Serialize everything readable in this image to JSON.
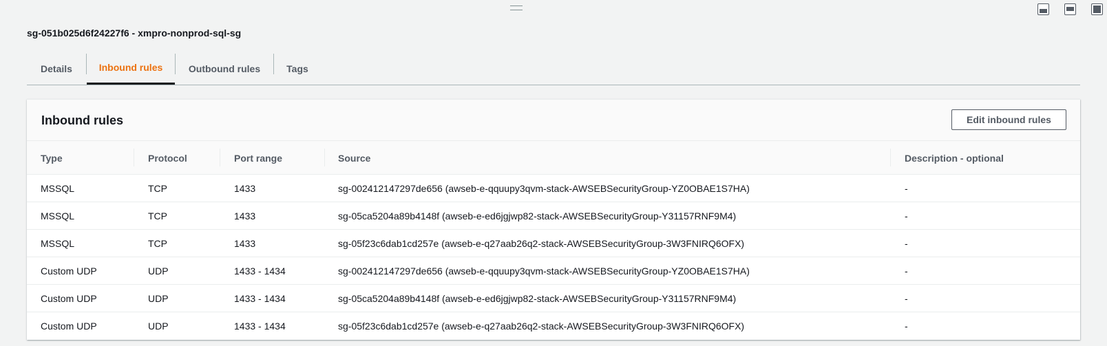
{
  "security_group_title": "sg-051b025d6f24227f6 - xmpro-nonprod-sql-sg",
  "tabs": [
    {
      "label": "Details"
    },
    {
      "label": "Inbound rules"
    },
    {
      "label": "Outbound rules"
    },
    {
      "label": "Tags"
    }
  ],
  "active_tab": "Inbound rules",
  "panel": {
    "title": "Inbound rules",
    "edit_button_label": "Edit inbound rules"
  },
  "table": {
    "columns": [
      "Type",
      "Protocol",
      "Port range",
      "Source",
      "Description - optional"
    ],
    "rows": [
      {
        "type": "MSSQL",
        "protocol": "TCP",
        "port_range": "1433",
        "source": "sg-002412147297de656 (awseb-e-qquupy3qvm-stack-AWSEBSecurityGroup-YZ0OBAE1S7HA)",
        "description": "-"
      },
      {
        "type": "MSSQL",
        "protocol": "TCP",
        "port_range": "1433",
        "source": "sg-05ca5204a89b4148f (awseb-e-ed6jgjwp82-stack-AWSEBSecurityGroup-Y31157RNF9M4)",
        "description": "-"
      },
      {
        "type": "MSSQL",
        "protocol": "TCP",
        "port_range": "1433",
        "source": "sg-05f23c6dab1cd257e (awseb-e-q27aab26q2-stack-AWSEBSecurityGroup-3W3FNIRQ6OFX)",
        "description": "-"
      },
      {
        "type": "Custom UDP",
        "protocol": "UDP",
        "port_range": "1433 - 1434",
        "source": "sg-002412147297de656 (awseb-e-qquupy3qvm-stack-AWSEBSecurityGroup-YZ0OBAE1S7HA)",
        "description": "-"
      },
      {
        "type": "Custom UDP",
        "protocol": "UDP",
        "port_range": "1433 - 1434",
        "source": "sg-05ca5204a89b4148f (awseb-e-ed6jgjwp82-stack-AWSEBSecurityGroup-Y31157RNF9M4)",
        "description": "-"
      },
      {
        "type": "Custom UDP",
        "protocol": "UDP",
        "port_range": "1433 - 1434",
        "source": "sg-05f23c6dab1cd257e (awseb-e-q27aab26q2-stack-AWSEBSecurityGroup-3W3FNIRQ6OFX)",
        "description": "-"
      }
    ]
  },
  "colors": {
    "active_tab": "#ec7211",
    "text": "#16191f",
    "muted_text": "#545b64"
  }
}
